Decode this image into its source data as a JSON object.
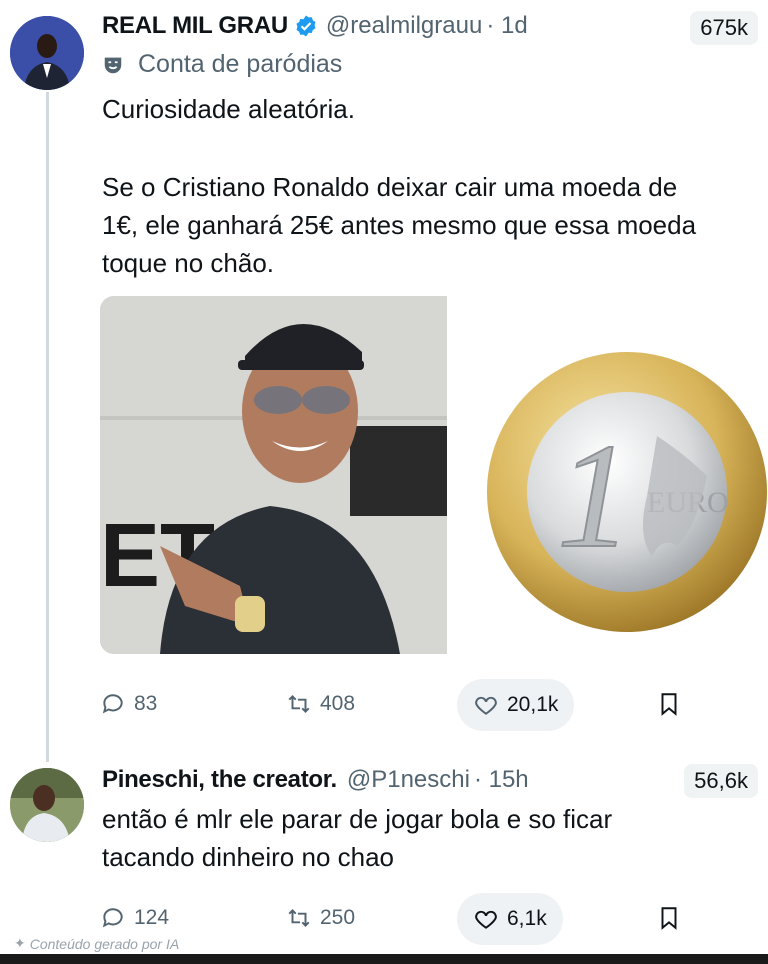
{
  "tweet": {
    "author_name": "REAL MIL GRAU",
    "handle": "@realmilgrauu",
    "time": "· 1d",
    "views": "675k",
    "parody_label": "Conta de paródias",
    "lines": [
      "Curiosidade aleatória.",
      "Se o Cristiano Ronaldo deixar cair uma moeda de",
      "1€, ele ganhará 25€ antes mesmo que essa moeda",
      "toque no chão."
    ],
    "stats": {
      "replies": "83",
      "retweets": "408",
      "likes": "20,1k"
    },
    "coin": {
      "numeral": "1",
      "word": "EURO"
    }
  },
  "reply": {
    "author_name": "Pineschi, the creator.",
    "handle": "@P1neschi",
    "time": "· 15h",
    "views": "56,6k",
    "lines": [
      "então é mlr ele parar de jogar bola e so ficar",
      "tacando dinheiro no chao"
    ],
    "stats": {
      "replies": "124",
      "retweets": "250",
      "likes": "6,1k"
    }
  },
  "watermark": "Conteúdo gerado por IA",
  "colors": {
    "verified": "#1d9bf0",
    "secondary_text": "#536471",
    "like_pill": "#eef2f4"
  }
}
